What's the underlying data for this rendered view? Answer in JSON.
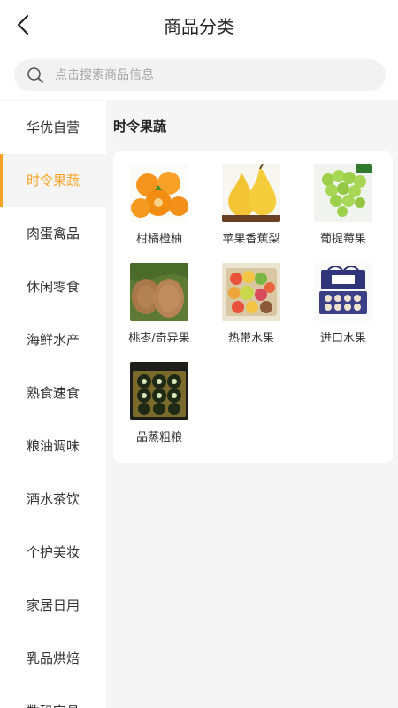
{
  "header": {
    "title": "商品分类"
  },
  "search": {
    "placeholder": "点击搜索商品信息"
  },
  "sidebar": {
    "items": [
      {
        "label": "华优自营"
      },
      {
        "label": "时令果蔬",
        "active": true
      },
      {
        "label": "肉蛋禽品"
      },
      {
        "label": "休闲零食"
      },
      {
        "label": "海鲜水产"
      },
      {
        "label": "熟食速食"
      },
      {
        "label": "粮油调味"
      },
      {
        "label": "酒水茶饮"
      },
      {
        "label": "个护美妆"
      },
      {
        "label": "家居日用"
      },
      {
        "label": "乳品烘焙"
      },
      {
        "label": "数码家具"
      }
    ]
  },
  "section": {
    "title": "时令果蔬"
  },
  "products": [
    {
      "label": "柑橘橙柚"
    },
    {
      "label": "苹果香蕉梨"
    },
    {
      "label": "葡提莓果"
    },
    {
      "label": "桃枣/奇异果"
    },
    {
      "label": "热带水果"
    },
    {
      "label": "进口水果"
    },
    {
      "label": "品蒸粗粮"
    }
  ],
  "colors": {
    "accent": "#f7a325",
    "background": "#f5f5f5"
  }
}
